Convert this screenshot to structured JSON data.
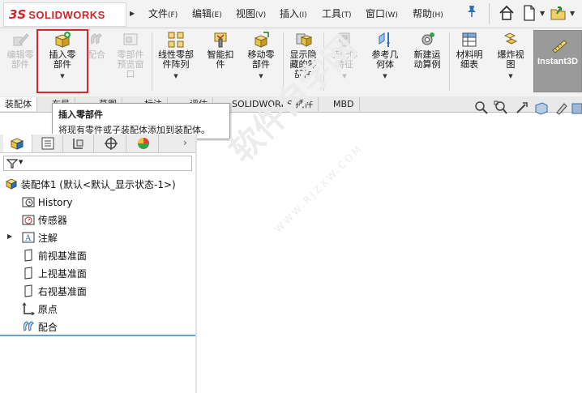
{
  "app": {
    "logo_mark": "3S",
    "logo_text": "SOLIDWORKS"
  },
  "menu": [
    {
      "label": "文件",
      "key": "(F)"
    },
    {
      "label": "编辑",
      "key": "(E)"
    },
    {
      "label": "视图",
      "key": "(V)"
    },
    {
      "label": "插入",
      "key": "(I)"
    },
    {
      "label": "工具",
      "key": "(T)"
    },
    {
      "label": "窗口",
      "key": "(W)"
    },
    {
      "label": "帮助",
      "key": "(H)"
    }
  ],
  "ribbon": {
    "edit_component": "编辑零\n部件",
    "insert_component": "插入零\n部件",
    "mate": "配合",
    "component_preview": "零部件\n预览窗\n口",
    "linear_pattern": "线性零部\n件阵列",
    "smart_fasteners": "智能扣\n件",
    "move_component": "移动零\n部件",
    "show_hidden": "显示隐\n藏的零\n部件",
    "assembly_features": "装配体\n特征",
    "reference_geometry": "参考几\n何体",
    "new_motion_study": "新建运\n动算例",
    "bom": "材料明\n细表",
    "exploded_view": "爆炸视\n图",
    "instant3d": "Instant3D"
  },
  "tabs": [
    "装配体",
    "布局",
    "草图",
    "标注",
    "评估",
    "SOLIDWORKS 插件",
    "MBD"
  ],
  "tooltip": {
    "title": "插入零部件",
    "description": "将现有零件或子装配体添加到装配体。"
  },
  "tree": {
    "root": "装配体1  (默认<默认_显示状态-1>)",
    "items": [
      "History",
      "传感器",
      "注解",
      "前视基准面",
      "上视基准面",
      "右视基准面",
      "原点",
      "配合"
    ]
  },
  "watermark": {
    "main": "软件自学网",
    "sub": "WWW.RJZXW.COM"
  },
  "colors": {
    "accent": "#d2232a",
    "highlight": "#e0242c"
  }
}
